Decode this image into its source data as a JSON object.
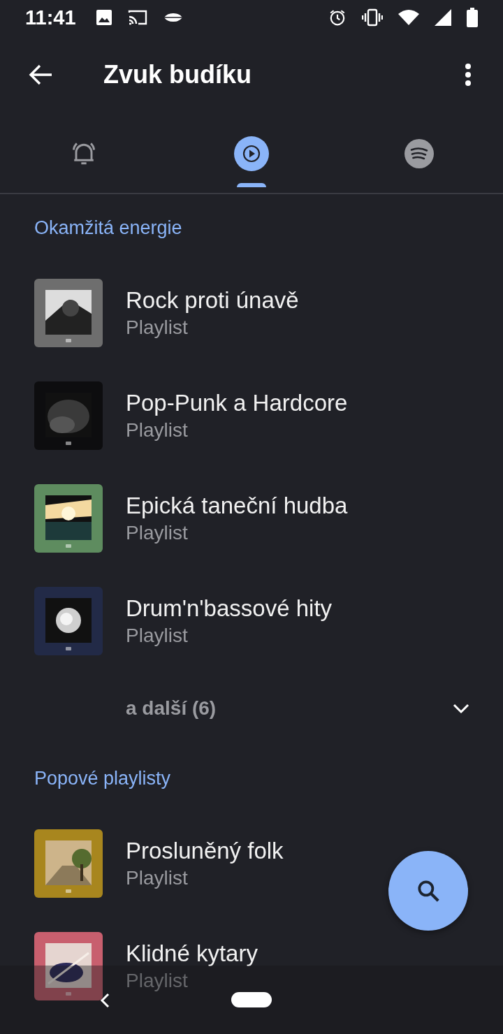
{
  "status_bar": {
    "time": "11:41"
  },
  "app_bar": {
    "title": "Zvuk budíku"
  },
  "tabs": [
    {
      "kind": "alarm",
      "selected": false
    },
    {
      "kind": "play",
      "selected": true
    },
    {
      "kind": "spotify",
      "selected": false
    }
  ],
  "sections": [
    {
      "title": "Okamžitá energie",
      "items": [
        {
          "kind": "picture",
          "title": "Rock proti únavě",
          "subtitle": "Playlist"
        },
        {
          "kind": "picture",
          "title": "Pop-Punk a Hardcore",
          "subtitle": "Playlist"
        },
        {
          "kind": "picture",
          "title": "Epická taneční hudba",
          "subtitle": "Playlist"
        },
        {
          "kind": "picture",
          "title": "Drum'n'bassové hity",
          "subtitle": "Playlist"
        }
      ],
      "more": {
        "label": "a další (6)",
        "expanded": false
      }
    },
    {
      "title": "Popové playlisty",
      "items": [
        {
          "kind": "picture",
          "title": "Prosluněný folk",
          "subtitle": "Playlist"
        },
        {
          "kind": "picture",
          "title": "Klidné kytary",
          "subtitle": "Playlist"
        }
      ]
    }
  ]
}
